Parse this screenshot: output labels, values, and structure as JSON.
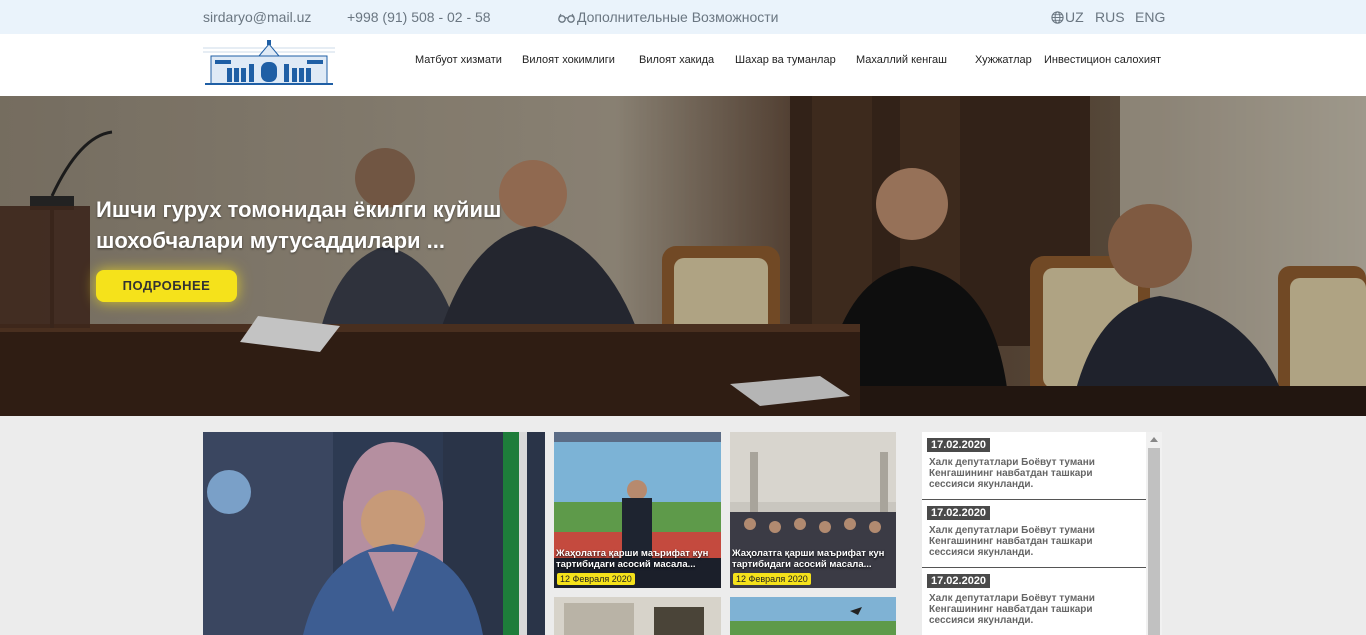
{
  "topbar": {
    "email": "sirdaryo@mail.uz",
    "phone": "+998 (91) 508 - 02 - 58",
    "accessibility": "Дополнительные Возможности",
    "languages": [
      "UZ",
      "RUS",
      "ENG"
    ]
  },
  "nav": {
    "items": [
      "Матбуот хизмати",
      "Вилоят хокимлиги",
      "Вилоят хакида",
      "Шахар ва туманлар",
      "Махаллий кенгаш",
      "Хужжатлар",
      "Инвестицион салохият"
    ]
  },
  "hero": {
    "title": "Ишчи гурух томонидан ёкилги куйиш шохобчалари мутусаддилари ...",
    "button": "ПОДРОБНЕЕ"
  },
  "news": [
    {
      "caption": "Жаҳолатга қарши маърифат кун тартибидаги асосий масала...",
      "date": "12 Февраля 2020"
    },
    {
      "caption": "Жаҳолатга қарши маърифат кун тартибидаги асосий масала...",
      "date": "12 Февраля 2020"
    }
  ],
  "feed": [
    {
      "date": "17.02.2020",
      "text": "Халк депутатлари Боёвут тумани Кенгашининг навбатдан ташкари сессияси якунланди."
    },
    {
      "date": "17.02.2020",
      "text": "Халк депутатлари Боёвут тумани Кенгашининг навбатдан ташкари сессияси якунланди."
    },
    {
      "date": "17.02.2020",
      "text": "Халк депутатлари Боёвут тумани Кенгашининг навбатдан ташкари сессияси якунланди."
    }
  ],
  "icons": {
    "accessibility": "glasses-icon",
    "language": "globe-icon",
    "logo": "government-building-logo"
  },
  "colors": {
    "topbar": "#eaf3fb",
    "accent": "#f5e21b",
    "logo": "#1f5fa5"
  }
}
